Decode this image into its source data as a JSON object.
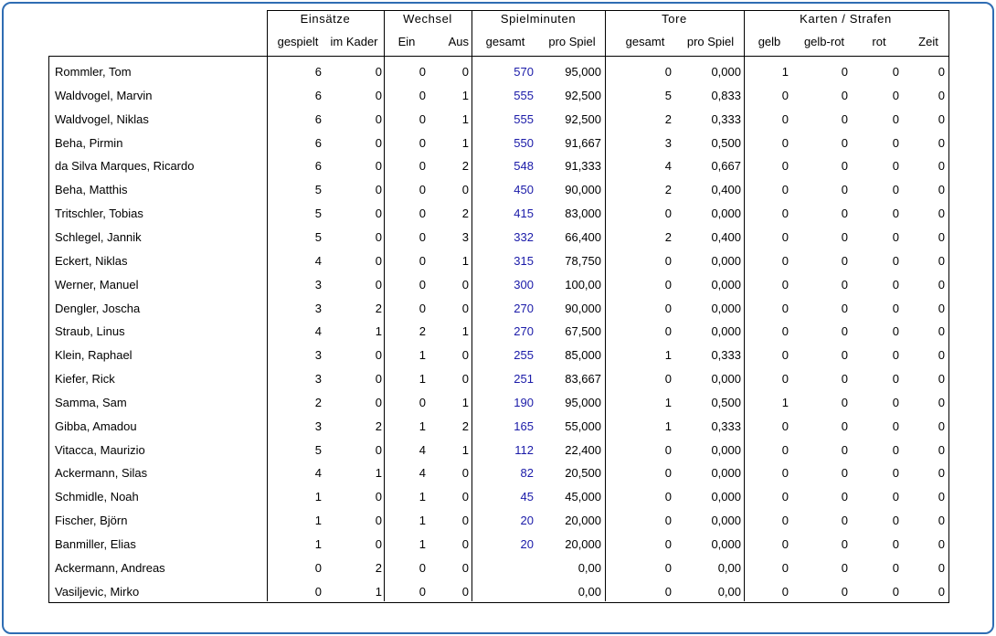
{
  "headers": {
    "groups": [
      "Einsätze",
      "Wechsel",
      "Spielminuten",
      "Tore",
      "Karten / Strafen"
    ],
    "columns": [
      "gespielt",
      "im Kader",
      "Ein",
      "Aus",
      "gesamt",
      "pro Spiel",
      "gesamt",
      "pro Spiel",
      "gelb",
      "gelb-rot",
      "rot",
      "Zeit"
    ]
  },
  "rows": [
    [
      "Rommler, Tom",
      "6",
      "0",
      "0",
      "0",
      "570",
      "95,000",
      "0",
      "0,000",
      "1",
      "0",
      "0",
      "0"
    ],
    [
      "Waldvogel, Marvin",
      "6",
      "0",
      "0",
      "1",
      "555",
      "92,500",
      "5",
      "0,833",
      "0",
      "0",
      "0",
      "0"
    ],
    [
      "Waldvogel, Niklas",
      "6",
      "0",
      "0",
      "1",
      "555",
      "92,500",
      "2",
      "0,333",
      "0",
      "0",
      "0",
      "0"
    ],
    [
      "Beha, Pirmin",
      "6",
      "0",
      "0",
      "1",
      "550",
      "91,667",
      "3",
      "0,500",
      "0",
      "0",
      "0",
      "0"
    ],
    [
      "da Silva Marques, Ricardo",
      "6",
      "0",
      "0",
      "2",
      "548",
      "91,333",
      "4",
      "0,667",
      "0",
      "0",
      "0",
      "0"
    ],
    [
      "Beha, Matthis",
      "5",
      "0",
      "0",
      "0",
      "450",
      "90,000",
      "2",
      "0,400",
      "0",
      "0",
      "0",
      "0"
    ],
    [
      "Tritschler, Tobias",
      "5",
      "0",
      "0",
      "2",
      "415",
      "83,000",
      "0",
      "0,000",
      "0",
      "0",
      "0",
      "0"
    ],
    [
      "Schlegel, Jannik",
      "5",
      "0",
      "0",
      "3",
      "332",
      "66,400",
      "2",
      "0,400",
      "0",
      "0",
      "0",
      "0"
    ],
    [
      "Eckert, Niklas",
      "4",
      "0",
      "0",
      "1",
      "315",
      "78,750",
      "0",
      "0,000",
      "0",
      "0",
      "0",
      "0"
    ],
    [
      "Werner, Manuel",
      "3",
      "0",
      "0",
      "0",
      "300",
      "100,00",
      "0",
      "0,000",
      "0",
      "0",
      "0",
      "0"
    ],
    [
      "Dengler, Joscha",
      "3",
      "2",
      "0",
      "0",
      "270",
      "90,000",
      "0",
      "0,000",
      "0",
      "0",
      "0",
      "0"
    ],
    [
      "Straub, Linus",
      "4",
      "1",
      "2",
      "1",
      "270",
      "67,500",
      "0",
      "0,000",
      "0",
      "0",
      "0",
      "0"
    ],
    [
      "Klein, Raphael",
      "3",
      "0",
      "1",
      "0",
      "255",
      "85,000",
      "1",
      "0,333",
      "0",
      "0",
      "0",
      "0"
    ],
    [
      "Kiefer, Rick",
      "3",
      "0",
      "1",
      "0",
      "251",
      "83,667",
      "0",
      "0,000",
      "0",
      "0",
      "0",
      "0"
    ],
    [
      "Samma, Sam",
      "2",
      "0",
      "0",
      "1",
      "190",
      "95,000",
      "1",
      "0,500",
      "1",
      "0",
      "0",
      "0"
    ],
    [
      "Gibba, Amadou",
      "3",
      "2",
      "1",
      "2",
      "165",
      "55,000",
      "1",
      "0,333",
      "0",
      "0",
      "0",
      "0"
    ],
    [
      "Vitacca, Maurizio",
      "5",
      "0",
      "4",
      "1",
      "112",
      "22,400",
      "0",
      "0,000",
      "0",
      "0",
      "0",
      "0"
    ],
    [
      "Ackermann, Silas",
      "4",
      "1",
      "4",
      "0",
      "82",
      "20,500",
      "0",
      "0,000",
      "0",
      "0",
      "0",
      "0"
    ],
    [
      "Schmidle, Noah",
      "1",
      "0",
      "1",
      "0",
      "45",
      "45,000",
      "0",
      "0,000",
      "0",
      "0",
      "0",
      "0"
    ],
    [
      "Fischer, Björn",
      "1",
      "0",
      "1",
      "0",
      "20",
      "20,000",
      "0",
      "0,000",
      "0",
      "0",
      "0",
      "0"
    ],
    [
      "Banmiller, Elias",
      "1",
      "0",
      "1",
      "0",
      "20",
      "20,000",
      "0",
      "0,000",
      "0",
      "0",
      "0",
      "0"
    ],
    [
      "Ackermann, Andreas",
      "0",
      "2",
      "0",
      "0",
      "",
      "0,00",
      "0",
      "0,00",
      "0",
      "0",
      "0",
      "0"
    ],
    [
      "Vasiljevic, Mirko",
      "0",
      "1",
      "0",
      "0",
      "",
      "0,00",
      "0",
      "0,00",
      "0",
      "0",
      "0",
      "0"
    ]
  ]
}
